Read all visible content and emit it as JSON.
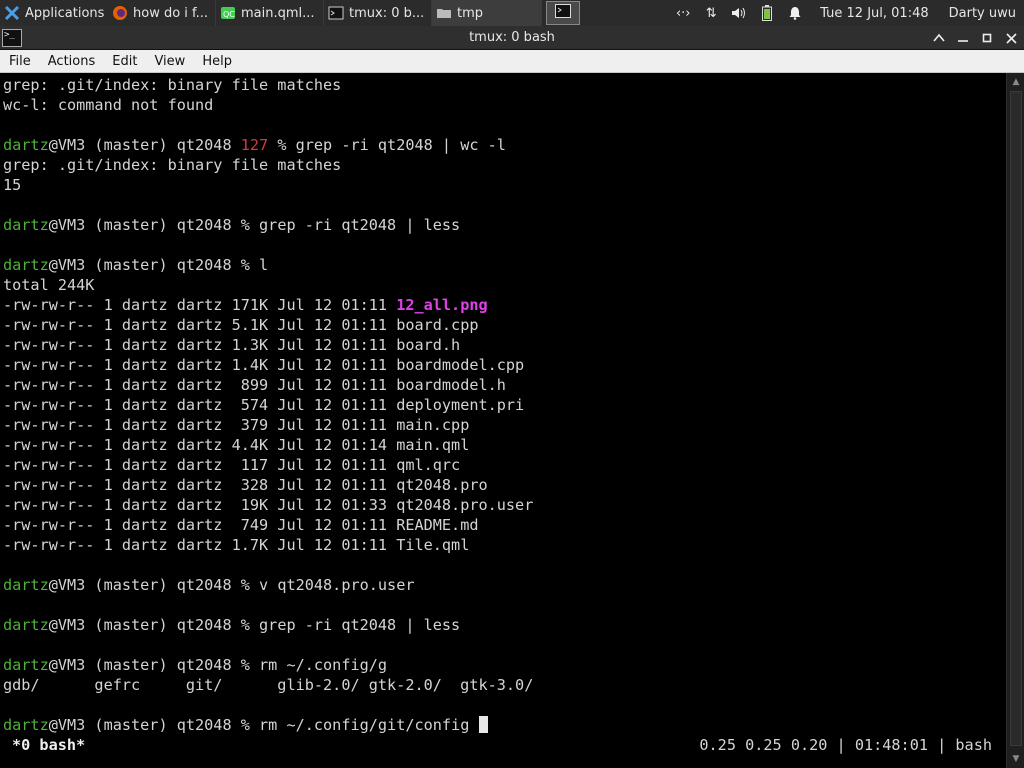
{
  "taskbar": {
    "applications_label": "Applications",
    "windows": [
      {
        "label": "how do i f...",
        "icon": "firefox-icon"
      },
      {
        "label": "main.qml...",
        "icon": "qtcreator-icon"
      },
      {
        "label": "tmux: 0 b...",
        "icon": "terminal-icon"
      },
      {
        "label": "tmp",
        "icon": "folder-icon"
      }
    ],
    "clock": "Tue 12 Jul, 01:48",
    "user": "Darty uwu"
  },
  "window": {
    "title": "tmux: 0 bash"
  },
  "menu": [
    "File",
    "Actions",
    "Edit",
    "View",
    "Help"
  ],
  "terminal": {
    "prompt": {
      "user": "dartz",
      "rest": "@VM3 (master) qt2048 "
    },
    "lines": [
      {
        "type": "text",
        "text": "grep: .git/index: binary file matches"
      },
      {
        "type": "text",
        "text": "wc-l: command not found"
      },
      {
        "type": "blank"
      },
      {
        "type": "prompt",
        "status": "127 ",
        "cmd": "% grep -ri qt2048 | wc -l"
      },
      {
        "type": "text",
        "text": "grep: .git/index: binary file matches"
      },
      {
        "type": "text",
        "text": "15"
      },
      {
        "type": "blank"
      },
      {
        "type": "prompt",
        "cmd": "% grep -ri qt2048 | less"
      },
      {
        "type": "blank"
      },
      {
        "type": "prompt",
        "cmd": "% l"
      },
      {
        "type": "text",
        "text": "total 244K"
      },
      {
        "type": "file",
        "meta": "-rw-rw-r-- 1 dartz dartz 171K Jul 12 01:11 ",
        "name": "12_all.png",
        "highlight": true
      },
      {
        "type": "file",
        "meta": "-rw-rw-r-- 1 dartz dartz 5.1K Jul 12 01:11 ",
        "name": "board.cpp"
      },
      {
        "type": "file",
        "meta": "-rw-rw-r-- 1 dartz dartz 1.3K Jul 12 01:11 ",
        "name": "board.h"
      },
      {
        "type": "file",
        "meta": "-rw-rw-r-- 1 dartz dartz 1.4K Jul 12 01:11 ",
        "name": "boardmodel.cpp"
      },
      {
        "type": "file",
        "meta": "-rw-rw-r-- 1 dartz dartz  899 Jul 12 01:11 ",
        "name": "boardmodel.h"
      },
      {
        "type": "file",
        "meta": "-rw-rw-r-- 1 dartz dartz  574 Jul 12 01:11 ",
        "name": "deployment.pri"
      },
      {
        "type": "file",
        "meta": "-rw-rw-r-- 1 dartz dartz  379 Jul 12 01:11 ",
        "name": "main.cpp"
      },
      {
        "type": "file",
        "meta": "-rw-rw-r-- 1 dartz dartz 4.4K Jul 12 01:14 ",
        "name": "main.qml"
      },
      {
        "type": "file",
        "meta": "-rw-rw-r-- 1 dartz dartz  117 Jul 12 01:11 ",
        "name": "qml.qrc"
      },
      {
        "type": "file",
        "meta": "-rw-rw-r-- 1 dartz dartz  328 Jul 12 01:11 ",
        "name": "qt2048.pro"
      },
      {
        "type": "file",
        "meta": "-rw-rw-r-- 1 dartz dartz  19K Jul 12 01:33 ",
        "name": "qt2048.pro.user"
      },
      {
        "type": "file",
        "meta": "-rw-rw-r-- 1 dartz dartz  749 Jul 12 01:11 ",
        "name": "README.md"
      },
      {
        "type": "file",
        "meta": "-rw-rw-r-- 1 dartz dartz 1.7K Jul 12 01:11 ",
        "name": "Tile.qml"
      },
      {
        "type": "blank"
      },
      {
        "type": "prompt",
        "cmd": "% v qt2048.pro.user"
      },
      {
        "type": "blank"
      },
      {
        "type": "prompt",
        "cmd": "% grep -ri qt2048 | less"
      },
      {
        "type": "blank"
      },
      {
        "type": "prompt",
        "cmd": "% rm ~/.config/g"
      },
      {
        "type": "text",
        "text": "gdb/      gefrc     git/      glib-2.0/ gtk-2.0/  gtk-3.0/"
      },
      {
        "type": "blank"
      },
      {
        "type": "prompt",
        "cmd": "% rm ~/.config/git/config ",
        "cursor": true
      }
    ]
  },
  "tmux_status": {
    "left": "*0 bash*",
    "right": "0.25 0.25 0.20 | 01:48:01 | bash"
  },
  "colors": {
    "prompt_user": "#4fb03c",
    "exit_status": "#d23b3b",
    "png_file": "#e040e8",
    "terminal_bg": "#000000",
    "panel_bg": "#2b2b2b"
  }
}
